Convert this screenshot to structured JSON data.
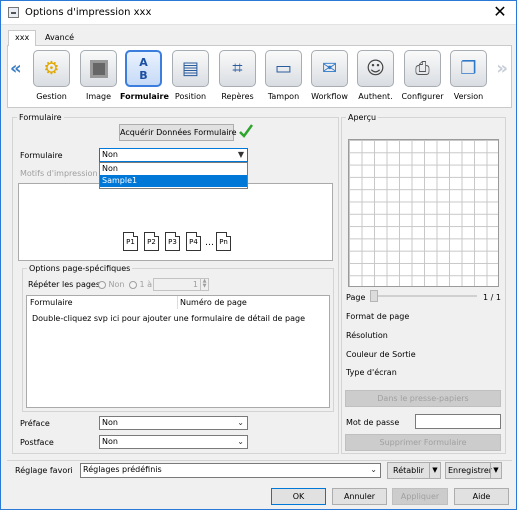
{
  "window": {
    "title": "Options d'impression xxx"
  },
  "tabs": [
    "xxx",
    "Avancé"
  ],
  "toolbar": {
    "left_arrow": "«",
    "right_arrow": "»",
    "items": [
      "Gestion",
      "Image",
      "Formulaire",
      "Position",
      "Repères",
      "Tampon",
      "Workflow",
      "Authent.",
      "Configurer",
      "Version"
    ],
    "selected": "Formulaire"
  },
  "formulaire_group": {
    "title": "Formulaire",
    "acquire_button": "Acquérir Données Formulaire",
    "form_label": "Formulaire",
    "form_value": "Non",
    "dropdown_options": [
      "Non",
      "Sample1"
    ],
    "motifs_label": "Motifs d'impression",
    "pages": [
      "P1",
      "P2",
      "P3",
      "P4",
      "…",
      "Pn"
    ]
  },
  "options_group": {
    "title": "Options page-spécifiques",
    "repeat_label": "Répéter les pages",
    "radio_non": "Non",
    "radio_1a": "1 à",
    "spin_value": "1",
    "col_formulaire": "Formulaire",
    "col_page": "Numéro de page",
    "hint": "Double-cliquez svp ici pour ajouter une formulaire de détail de page"
  },
  "preface": {
    "label": "Préface",
    "value": "Non"
  },
  "postface": {
    "label": "Postface",
    "value": "Non"
  },
  "apercu": {
    "title": "Aperçu",
    "page_label": "Page",
    "page_count": "1 / 1",
    "fields": [
      "Format de page",
      "Résolution",
      "Couleur de Sortie",
      "Type d'écran"
    ],
    "clipboard_button": "Dans le presse-papiers",
    "password_label": "Mot de passe",
    "delete_button": "Supprimer Formulaire"
  },
  "favorites": {
    "label": "Réglage favori",
    "value": "Réglages prédéfinis",
    "reset_button": "Rétablir",
    "save_button": "Enregistrer"
  },
  "footer": {
    "ok": "OK",
    "cancel": "Annuler",
    "apply": "Appliquer",
    "help": "Aide"
  },
  "colors": {
    "accent": "#0078d7",
    "check": "#2da52d",
    "arrow": "#3b7dc4"
  }
}
